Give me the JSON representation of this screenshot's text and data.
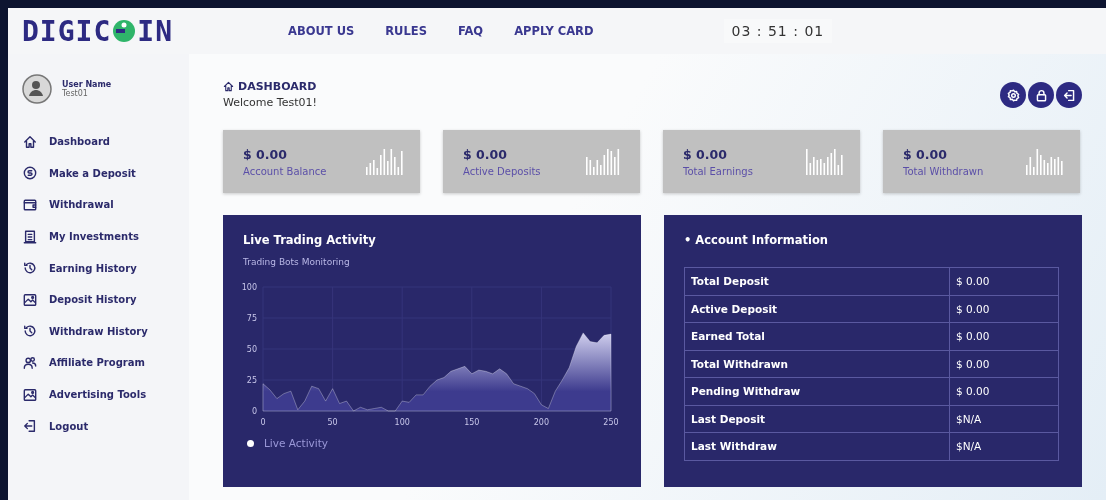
{
  "logo": {
    "left": "DIGIC",
    "right": "IN"
  },
  "nav": [
    {
      "label": "ABOUT US"
    },
    {
      "label": "RULES"
    },
    {
      "label": "FAQ"
    },
    {
      "label": "APPLY CARD"
    }
  ],
  "clock": "03 : 51 : 01",
  "user": {
    "label": "User Name",
    "name": "Test01"
  },
  "sidebar": {
    "items": [
      {
        "label": "Dashboard"
      },
      {
        "label": "Make a Deposit"
      },
      {
        "label": "Withdrawal"
      },
      {
        "label": "My Investments"
      },
      {
        "label": "Earning History"
      },
      {
        "label": "Deposit History"
      },
      {
        "label": "Withdraw History"
      },
      {
        "label": "Affiliate Program"
      },
      {
        "label": "Advertising Tools"
      },
      {
        "label": "Logout"
      }
    ]
  },
  "breadcrumb": "DASHBOARD",
  "welcome": "Welcome Test01!",
  "stats": [
    {
      "value": "$ 0.00",
      "label": "Account Balance"
    },
    {
      "value": "$ 0.00",
      "label": "Active Deposits"
    },
    {
      "value": "$ 0.00",
      "label": "Total Earnings"
    },
    {
      "value": "$ 0.00",
      "label": "Total Withdrawn"
    }
  ],
  "trading": {
    "title": "Live Trading Activity",
    "subtitle": "Trading Bots Monitoring",
    "chart_data": {
      "type": "area",
      "x": [
        0,
        5,
        10,
        15,
        20,
        25,
        30,
        35,
        40,
        45,
        50,
        55,
        60,
        65,
        70,
        75,
        80,
        85,
        90,
        95,
        100,
        105,
        110,
        115,
        120,
        125,
        130,
        135,
        140,
        145,
        150,
        155,
        160,
        165,
        170,
        175,
        180,
        185,
        190,
        195,
        200,
        205,
        210,
        215,
        220,
        225,
        230,
        235,
        240,
        245,
        250
      ],
      "series": [
        {
          "name": "Live Activity",
          "color": "#ffffff",
          "values": [
            22,
            17,
            10,
            14,
            16,
            1,
            8,
            20,
            18,
            8,
            18,
            6,
            8,
            0,
            3,
            1,
            2,
            3,
            0,
            0,
            8,
            7,
            13,
            13,
            20,
            25,
            27,
            32,
            34,
            36,
            30,
            33,
            32,
            30,
            34,
            30,
            22,
            20,
            18,
            14,
            5,
            2,
            16,
            25,
            35,
            52,
            63,
            56,
            55,
            61,
            62
          ]
        }
      ],
      "grid": true,
      "xlim": [
        0,
        250
      ],
      "ylim": [
        0,
        100
      ],
      "xticks": [
        0,
        50,
        100,
        150,
        200,
        250
      ],
      "yticks": [
        0,
        25,
        50,
        75,
        100
      ]
    }
  },
  "account": {
    "title": "• Account Information",
    "rows": [
      {
        "label": "Total Deposit",
        "value": "$ 0.00"
      },
      {
        "label": "Active Deposit",
        "value": "$ 0.00"
      },
      {
        "label": "Earned Total",
        "value": "$ 0.00"
      },
      {
        "label": "Total Withdrawn",
        "value": "$ 0.00"
      },
      {
        "label": "Pending Withdraw",
        "value": "$ 0.00"
      },
      {
        "label": "Last Deposit",
        "value": "$N/A"
      },
      {
        "label": "Last Withdraw",
        "value": "$N/A"
      }
    ]
  }
}
